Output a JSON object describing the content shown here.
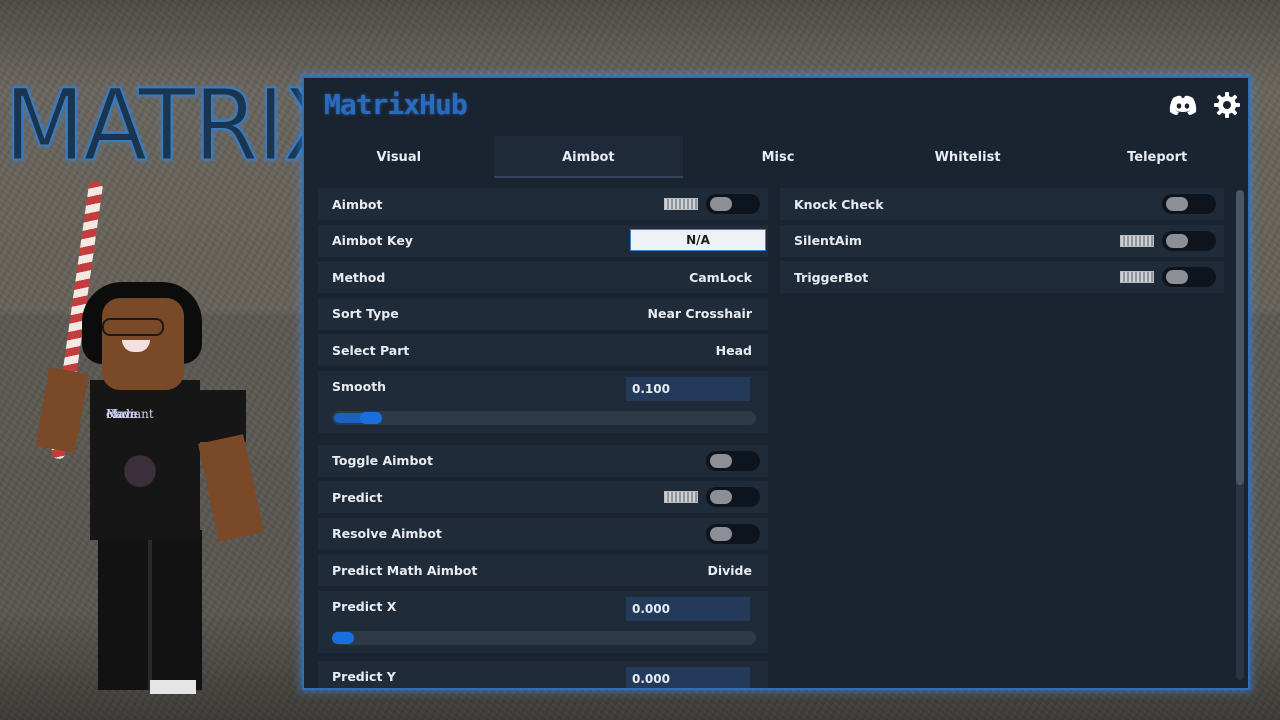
{
  "backdrop": {
    "brand_text": "MATRIX",
    "shirt_lines": [
      "Radiant",
      "clove",
      "Main"
    ]
  },
  "window": {
    "title": "MatrixHub",
    "accent_color": "#2d70b8",
    "icons": [
      "discord-icon",
      "gear-icon"
    ]
  },
  "tabs": [
    {
      "label": "Visual",
      "active": false
    },
    {
      "label": "Aimbot",
      "active": true
    },
    {
      "label": "Misc",
      "active": false
    },
    {
      "label": "Whitelist",
      "active": false
    },
    {
      "label": "Teleport",
      "active": false
    }
  ],
  "left": {
    "aimbot": {
      "label": "Aimbot",
      "enabled": false
    },
    "aimbot_key": {
      "label": "Aimbot Key",
      "value": "N/A"
    },
    "method": {
      "label": "Method",
      "value": "CamLock"
    },
    "sort_type": {
      "label": "Sort Type",
      "value": "Near Crosshair"
    },
    "select_part": {
      "label": "Select Part",
      "value": "Head"
    },
    "smooth": {
      "label": "Smooth",
      "value": "0.100",
      "level": 0.1
    },
    "toggle_aimbot": {
      "label": "Toggle Aimbot",
      "enabled": false
    },
    "predict": {
      "label": "Predict",
      "enabled": false
    },
    "resolve_aimbot": {
      "label": "Resolve Aimbot",
      "enabled": false
    },
    "predict_math": {
      "label": "Predict Math Aimbot",
      "value": "Divide"
    },
    "predict_x": {
      "label": "Predict X",
      "value": "0.000",
      "level": 0.0
    },
    "predict_y": {
      "label": "Predict Y",
      "value": "0.000"
    }
  },
  "right": {
    "knock_check": {
      "label": "Knock Check",
      "enabled": false
    },
    "silent_aim": {
      "label": "SilentAim",
      "enabled": false
    },
    "trigger_bot": {
      "label": "TriggerBot",
      "enabled": false
    }
  }
}
